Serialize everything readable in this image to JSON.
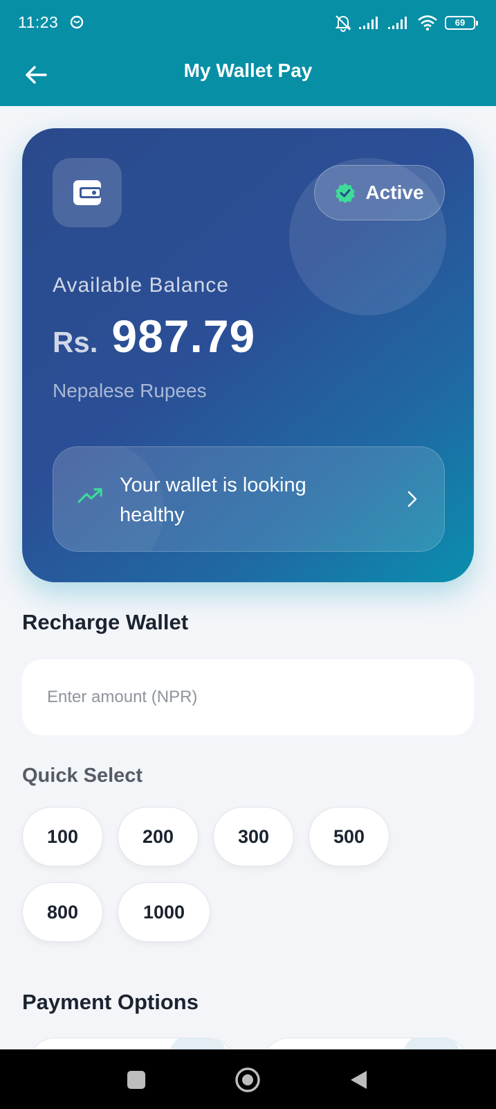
{
  "status_bar": {
    "time": "11:23",
    "battery": "69"
  },
  "app_bar": {
    "title": "My Wallet Pay"
  },
  "wallet_card": {
    "status_label": "Active",
    "balance_label": "Available Balance",
    "currency": "Rs.",
    "amount": "987.79",
    "currency_name": "Nepalese Rupees",
    "health_message": "Your wallet is looking healthy"
  },
  "recharge": {
    "title": "Recharge Wallet",
    "amount_placeholder": "Enter amount (NPR)",
    "quick_select_title": "Quick Select",
    "quick_amounts": [
      "100",
      "200",
      "300",
      "500",
      "800",
      "1000"
    ]
  },
  "payment": {
    "title": "Payment Options"
  },
  "colors": {
    "app_bar": "#078fa6",
    "card_start": "#2a4a8c",
    "card_end": "#0a8fae",
    "success_green": "#3ddc97"
  },
  "icons": [
    "alarm-icon",
    "mute-bell-icon",
    "signal-icon",
    "wifi-icon",
    "battery-icon",
    "back-arrow-icon",
    "wallet-icon",
    "verified-badge-icon",
    "trending-up-icon",
    "chevron-right-icon",
    "square-nav-icon",
    "home-nav-icon",
    "back-nav-icon"
  ]
}
